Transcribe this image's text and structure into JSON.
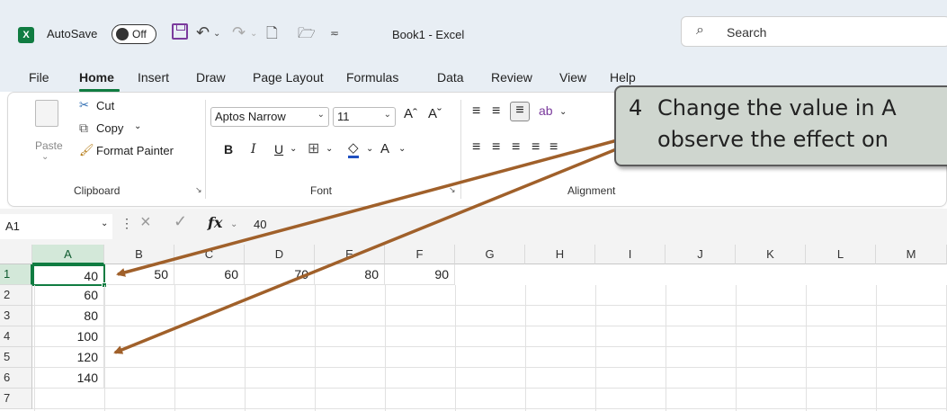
{
  "titlebar": {
    "app_letter": "X",
    "autosave_label": "AutoSave",
    "autosave_state": "Off",
    "doc_title": "Book1  -  Excel",
    "search_placeholder": "Search"
  },
  "menu_tabs": [
    "File",
    "Home",
    "Insert",
    "Draw",
    "Page Layout",
    "Formulas",
    "Data",
    "Review",
    "View",
    "Help"
  ],
  "active_tab": "Home",
  "ribbon": {
    "clipboard": {
      "paste": "Paste",
      "cut": "Cut",
      "copy": "Copy",
      "format_painter": "Format Painter",
      "group_label": "Clipboard"
    },
    "font": {
      "font_name": "Aptos Narrow",
      "font_size": "11",
      "group_label": "Font"
    },
    "alignment": {
      "group_label": "Alignment"
    }
  },
  "formula_bar": {
    "name_box": "A1",
    "fx": "fx",
    "value": "40"
  },
  "columns": [
    "A",
    "B",
    "C",
    "D",
    "E",
    "F",
    "G",
    "H",
    "I",
    "J",
    "K",
    "L",
    "M"
  ],
  "rows": [
    "1",
    "2",
    "3",
    "4",
    "5",
    "6",
    "7"
  ],
  "cells": {
    "A1": "40",
    "B1": "50",
    "C1": "60",
    "D1": "70",
    "E1": "80",
    "F1": "90",
    "A2": "60",
    "A3": "80",
    "A4": "100",
    "A5": "120",
    "A6": "140"
  },
  "callout": {
    "step": "4",
    "line1": "Change the value in A",
    "line2": "observe the effect on"
  },
  "colors": {
    "excel_green": "#107c41",
    "arrow_brown": "#a0602a",
    "callout_fill": "#cfd6cf"
  }
}
